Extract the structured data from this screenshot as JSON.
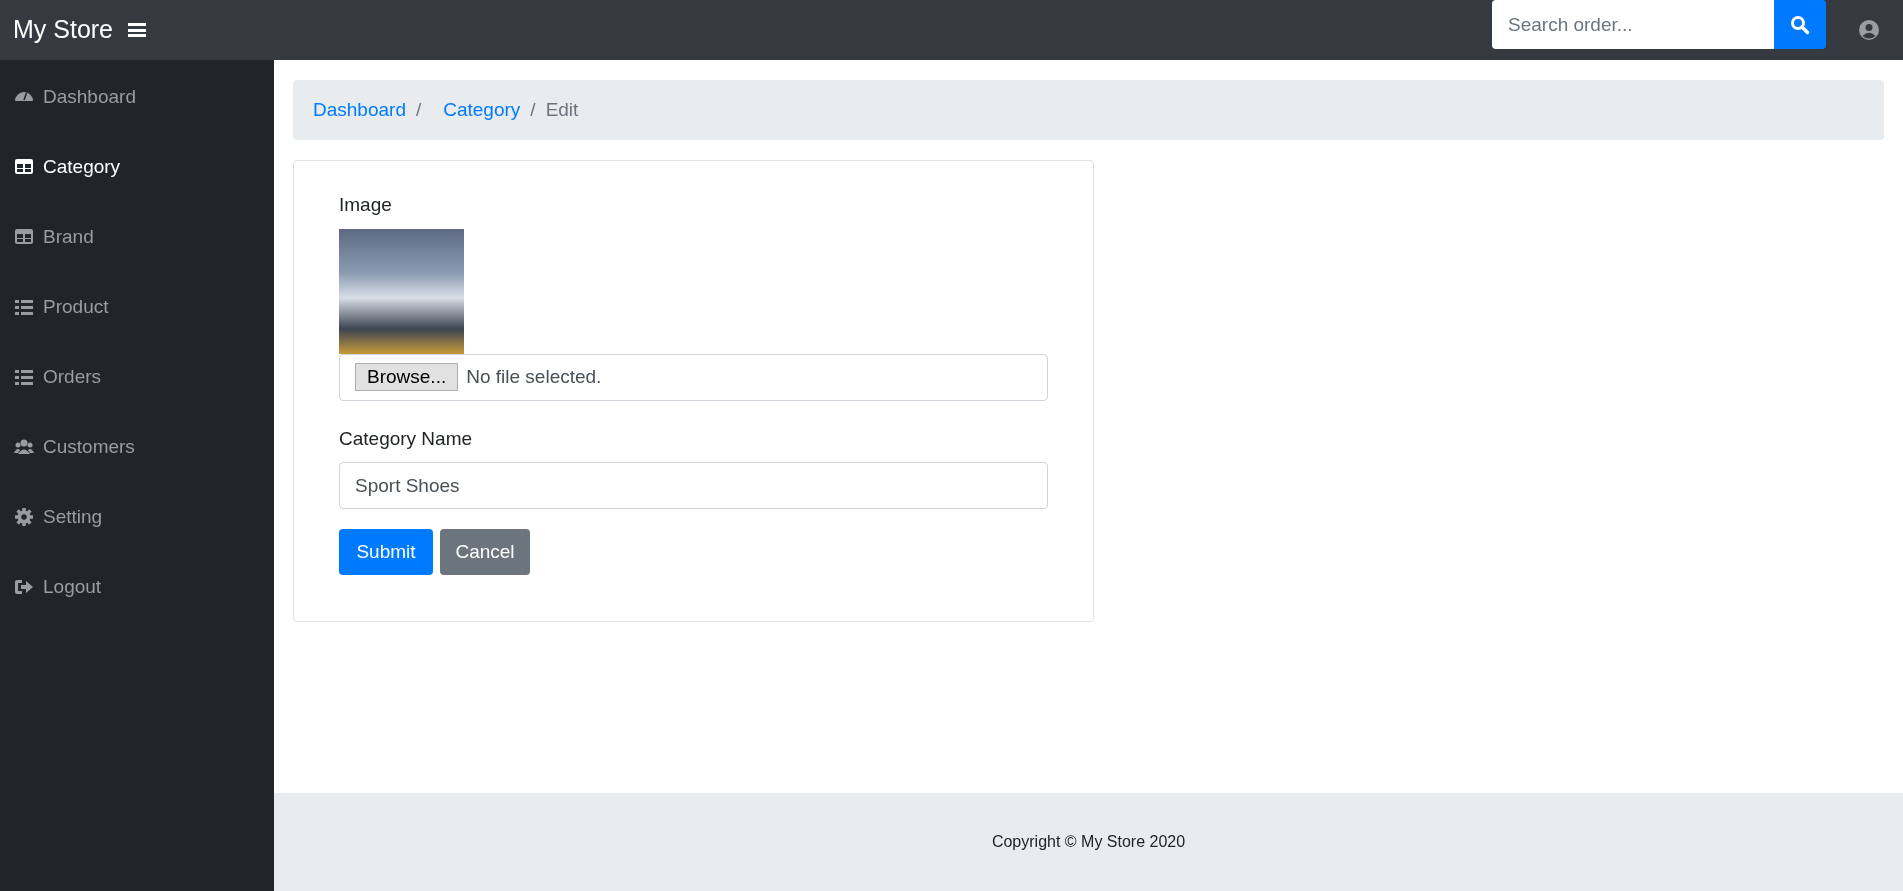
{
  "navbar": {
    "brand": "My Store",
    "search": {
      "placeholder": "Search order..."
    }
  },
  "sidebar": {
    "items": [
      {
        "label": "Dashboard",
        "selected": false
      },
      {
        "label": "Category",
        "selected": true
      },
      {
        "label": "Brand",
        "selected": false
      },
      {
        "label": "Product",
        "selected": false
      },
      {
        "label": "Orders",
        "selected": false
      },
      {
        "label": "Customers",
        "selected": false
      },
      {
        "label": "Setting",
        "selected": false
      },
      {
        "label": "Logout",
        "selected": false
      }
    ]
  },
  "breadcrumb": [
    {
      "label": "Dashboard",
      "current": false
    },
    {
      "separator": "/",
      "label": "Category",
      "current": false
    },
    {
      "separator": "/",
      "label": "Edit",
      "current": true
    }
  ],
  "form": {
    "image_label": "Image",
    "file": {
      "button": "Browse...",
      "status": "No file selected."
    },
    "name_label": "Category Name",
    "name_value": "Sport Shoes",
    "buttons": [
      {
        "label": "Submit",
        "kind": "primary"
      },
      {
        "label": "Cancel",
        "kind": "secondary"
      }
    ]
  },
  "footer": "Copyright © My Store 2020"
}
